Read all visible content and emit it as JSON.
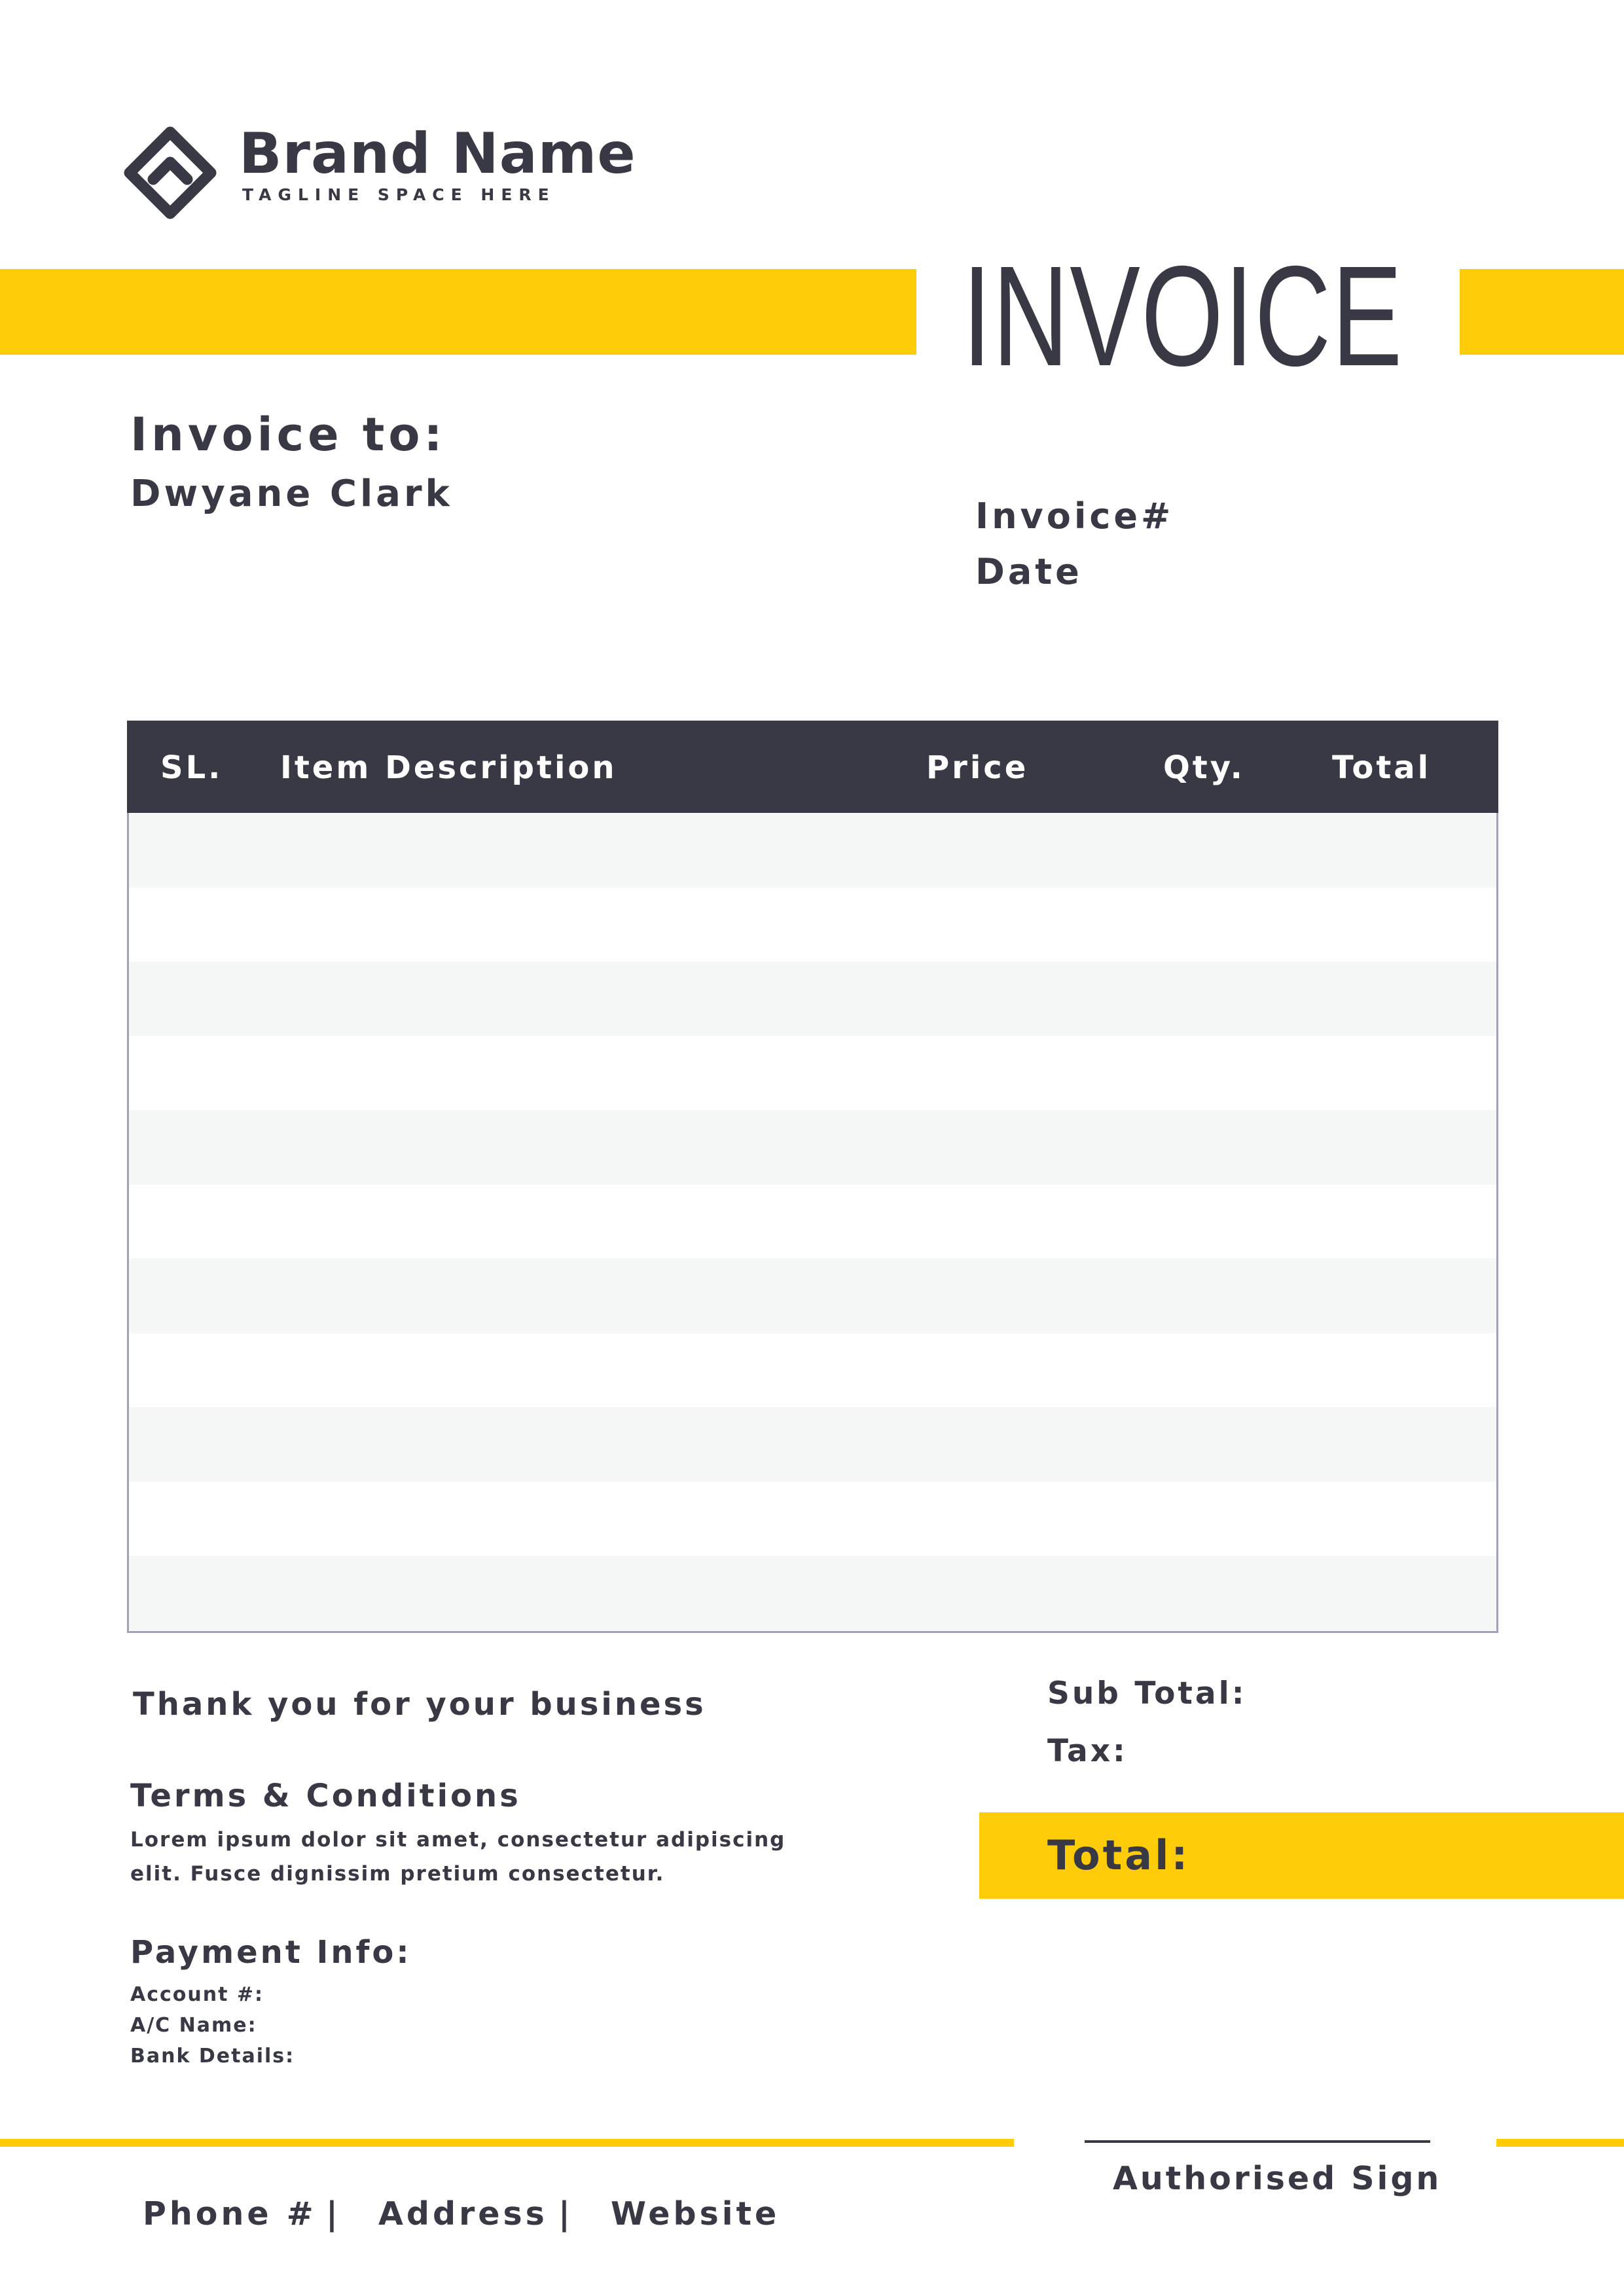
{
  "brand": {
    "name": "Brand Name",
    "tagline": "TAGLINE SPACE HERE",
    "logo_icon": "diamond-roof-logo-icon"
  },
  "header": {
    "title": "INVOICE"
  },
  "client": {
    "label": "Invoice to:",
    "name": "Dwyane Clark"
  },
  "meta": {
    "invoice_number_label": "Invoice#",
    "date_label": "Date"
  },
  "table": {
    "columns": [
      "SL.",
      "Item Description",
      "Price",
      "Qty.",
      "Total"
    ],
    "rows": [
      [],
      [],
      [],
      [],
      [],
      [],
      [],
      [],
      [],
      [],
      []
    ]
  },
  "notes": {
    "thanks": "Thank you for your business",
    "terms_title": "Terms & Conditions",
    "terms_line1": "Lorem ipsum dolor sit amet, consectetur adipiscing",
    "terms_line2": "elit. Fusce dignissim pretium consectetur."
  },
  "payment": {
    "title": "Payment Info:",
    "account_label": "Account #:",
    "ac_name_label": "A/C Name:",
    "bank_label": "Bank Details:"
  },
  "totals": {
    "subtotal_label": "Sub Total:",
    "tax_label": "Tax:",
    "total_label": "Total:"
  },
  "signature": {
    "label": "Authorised Sign"
  },
  "footer": {
    "phone": "Phone #",
    "separator": "|",
    "address": "Address",
    "website": "Website"
  },
  "colors": {
    "accent": "#FFCC09",
    "dark": "#383945",
    "row_shade": "#F6F7F7",
    "table_border": "#9EA3B8"
  }
}
